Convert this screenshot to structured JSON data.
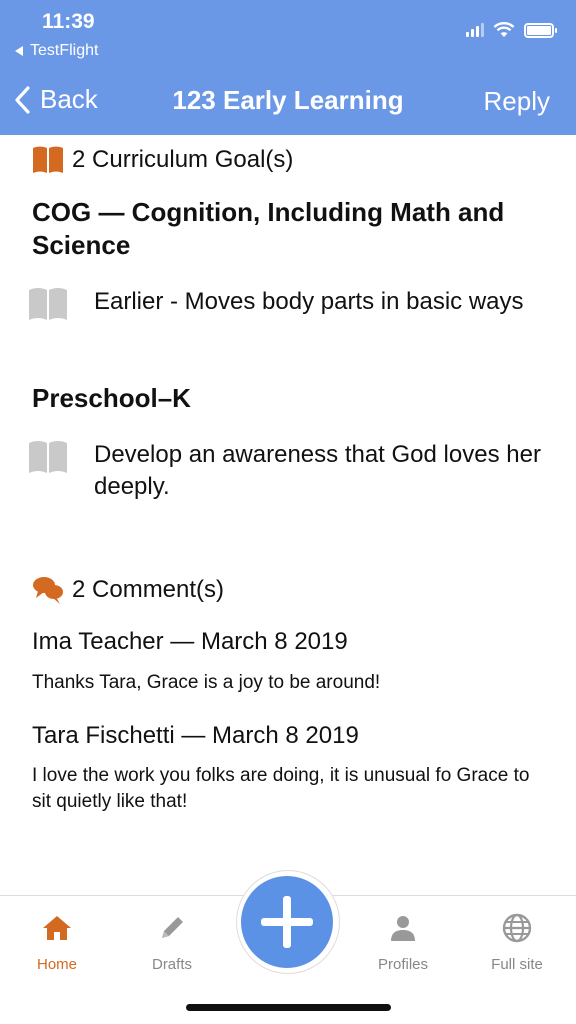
{
  "status": {
    "time": "11:39",
    "back_app": "TestFlight"
  },
  "nav": {
    "back": "Back",
    "title": "123 Early Learning",
    "reply": "Reply"
  },
  "goals": {
    "header": "2 Curriculum Goal(s)",
    "groups": [
      {
        "heading": "COG — Cognition, Including Math and Science",
        "item": "Earlier - Moves body parts in basic ways"
      },
      {
        "heading": "Preschool–K",
        "item": "Develop an awareness that God loves her deeply."
      }
    ]
  },
  "comments": {
    "header": "2 Comment(s)",
    "items": [
      {
        "author": "Ima Teacher — March 8 2019",
        "text": "Thanks Tara, Grace is a joy to be around!"
      },
      {
        "author": "Tara Fischetti — March 8 2019",
        "text": "I love the work you folks are doing, it is unusual fo Grace to sit quietly like that!"
      }
    ]
  },
  "tabs": {
    "home": "Home",
    "drafts": "Drafts",
    "profiles": "Profiles",
    "full_site": "Full site"
  },
  "colors": {
    "header": "#6b98e6",
    "accent": "#d46a22",
    "fab": "#5b92e5"
  },
  "icons": [
    "book-icon",
    "comments-icon",
    "home-icon",
    "pencil-icon",
    "plus-icon",
    "person-icon",
    "globe-icon"
  ]
}
